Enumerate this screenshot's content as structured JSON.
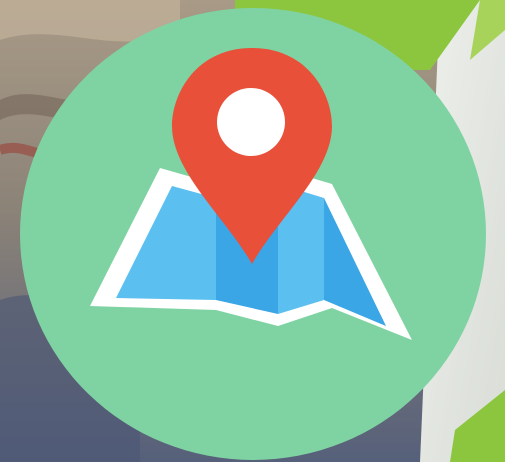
{
  "app_icon": {
    "icon": "map-pin-icon",
    "colors": {
      "circle_bg": "#7fd3a2",
      "pin": "#e8503a",
      "pin_dot": "#ffffff",
      "map_paper_border": "#ffffff",
      "map_blue_light": "#5bbff0",
      "map_blue_dark": "#3aa6e6",
      "corner_green": "#8cc63f"
    }
  }
}
